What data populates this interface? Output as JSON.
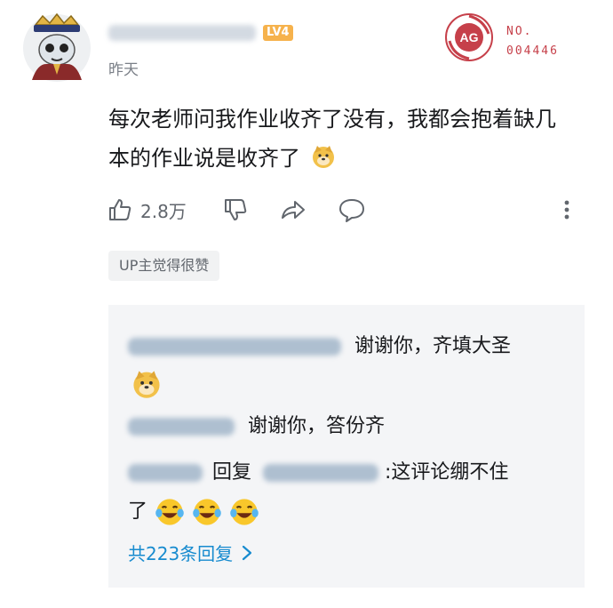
{
  "comment": {
    "level_badge": "LV4",
    "time": "昨天",
    "content_text": "每次老师问我作业收齐了没有，我都会抱着缺几本的作业说是收齐了",
    "actions": {
      "like_count": "2.8万"
    },
    "up_liked_label": "UP主觉得很赞"
  },
  "badge": {
    "no_label": "NO.",
    "number": "004446",
    "logo_text": "AG"
  },
  "replies": [
    {
      "text": "谢谢你，齐填大圣"
    },
    {
      "text": "谢谢你，答份齐"
    },
    {
      "prefix": "回复",
      "text": ":这评论绷不住",
      "text_line2": "了"
    }
  ],
  "more_replies": "共223条回复",
  "colors": {
    "link": "#178bcf",
    "badge_red": "#c6404a",
    "level": "#f6b24c"
  },
  "icons": [
    "thumbs-up-icon",
    "thumbs-down-icon",
    "share-icon",
    "comment-icon",
    "more-vertical-icon",
    "doge-emoji-icon",
    "laughing-tears-emoji-icon",
    "chevron-right-icon"
  ]
}
